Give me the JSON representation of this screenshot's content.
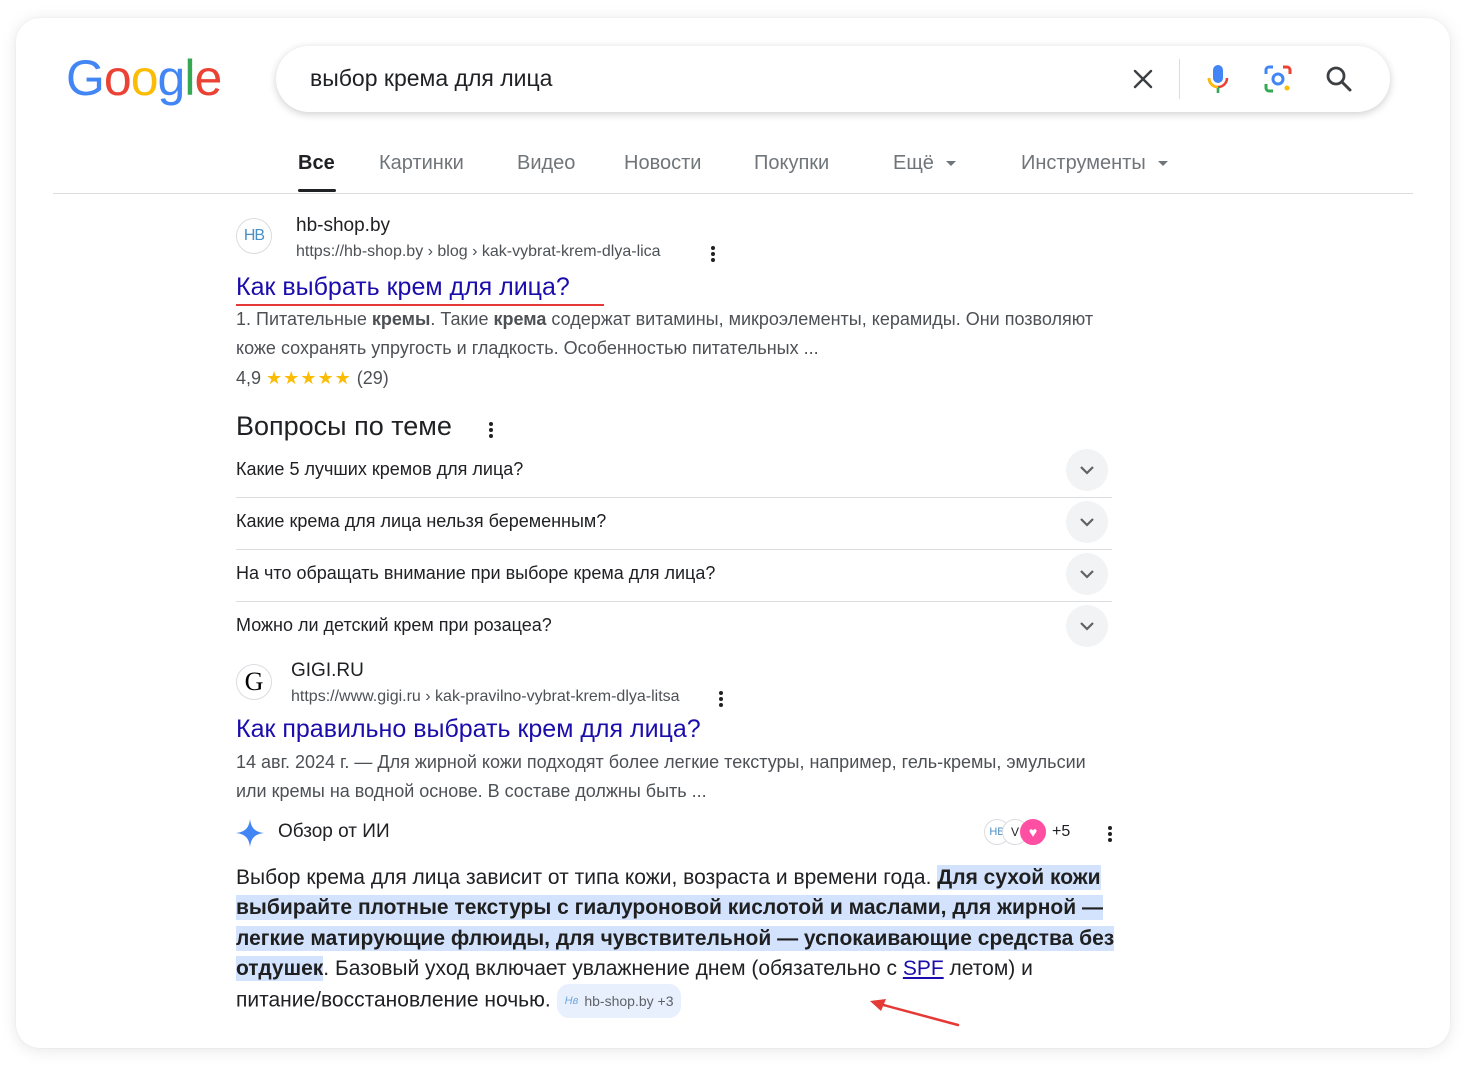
{
  "logo": {
    "letters": [
      "G",
      "o",
      "o",
      "g",
      "l",
      "e"
    ]
  },
  "search": {
    "query": "выбор крема для лица"
  },
  "icons": {
    "clear": "close-icon",
    "voice": "mic-icon",
    "lens": "lens-icon",
    "search": "search-icon"
  },
  "tabs": [
    {
      "label": "Все",
      "active": true
    },
    {
      "label": "Картинки"
    },
    {
      "label": "Видео"
    },
    {
      "label": "Новости"
    },
    {
      "label": "Покупки"
    },
    {
      "label": "Ещё"
    },
    {
      "label": "Инструменты"
    }
  ],
  "result1": {
    "favicon_text": "HB",
    "site": "hb-shop.by",
    "url": "https://hb-shop.by › blog › kak-vybrat-krem-dlya-lica",
    "title": "Как выбрать крем для лица?",
    "snippet_parts": [
      "1. Питательные ",
      "кремы",
      ". Такие ",
      "крема",
      " содержат витамины, микроэлементы, керамиды. Они позволяют коже сохранять упругость и гладкость. Особенностью питательных ..."
    ],
    "rating_value": "4,9",
    "stars": "★★★★★",
    "rating_count": "(29)"
  },
  "paa": {
    "title": "Вопросы по теме",
    "questions": [
      "Какие 5 лучших кремов для лица?",
      "Какие крема для лица нельзя беременным?",
      "На что обращать внимание при выборе крема для лица?",
      "Можно ли детский крем при розацеа?"
    ]
  },
  "result2": {
    "favicon_text": "G",
    "site": "GIGI.RU",
    "url": "https://www.gigi.ru › kak-pravilno-vybrat-krem-dlya-litsa",
    "title": "Как правильно выбрать крем для лица?",
    "snippet": "14 авг. 2024 г. — Для жирной кожи подходят более легкие текстуры, например, гель-кремы, эмульсии или кремы на водной основе. В составе должны быть ..."
  },
  "ai_overview": {
    "label": "Обзор от ИИ",
    "sources_more": "+5",
    "text_plain_1": "Выбор крема для лица зависит от типа кожи, возраста и времени года. ",
    "text_highlight": "Для сухой кожи выбирайте плотные текстуры с гиалуроновой кислотой и маслами, для жирной — легкие матирующие флюиды, для чувствительной — успокаивающие средства без отдушек",
    "text_plain_2": ". Базовый уход включает увлажнение днем (обязательно с ",
    "text_link": "SPF",
    "text_plain_3": " летом) и питание/восстановление ночью.",
    "chip_label": "hb-shop.by +3"
  },
  "annotation": {
    "arrow_color": "#e53935"
  }
}
